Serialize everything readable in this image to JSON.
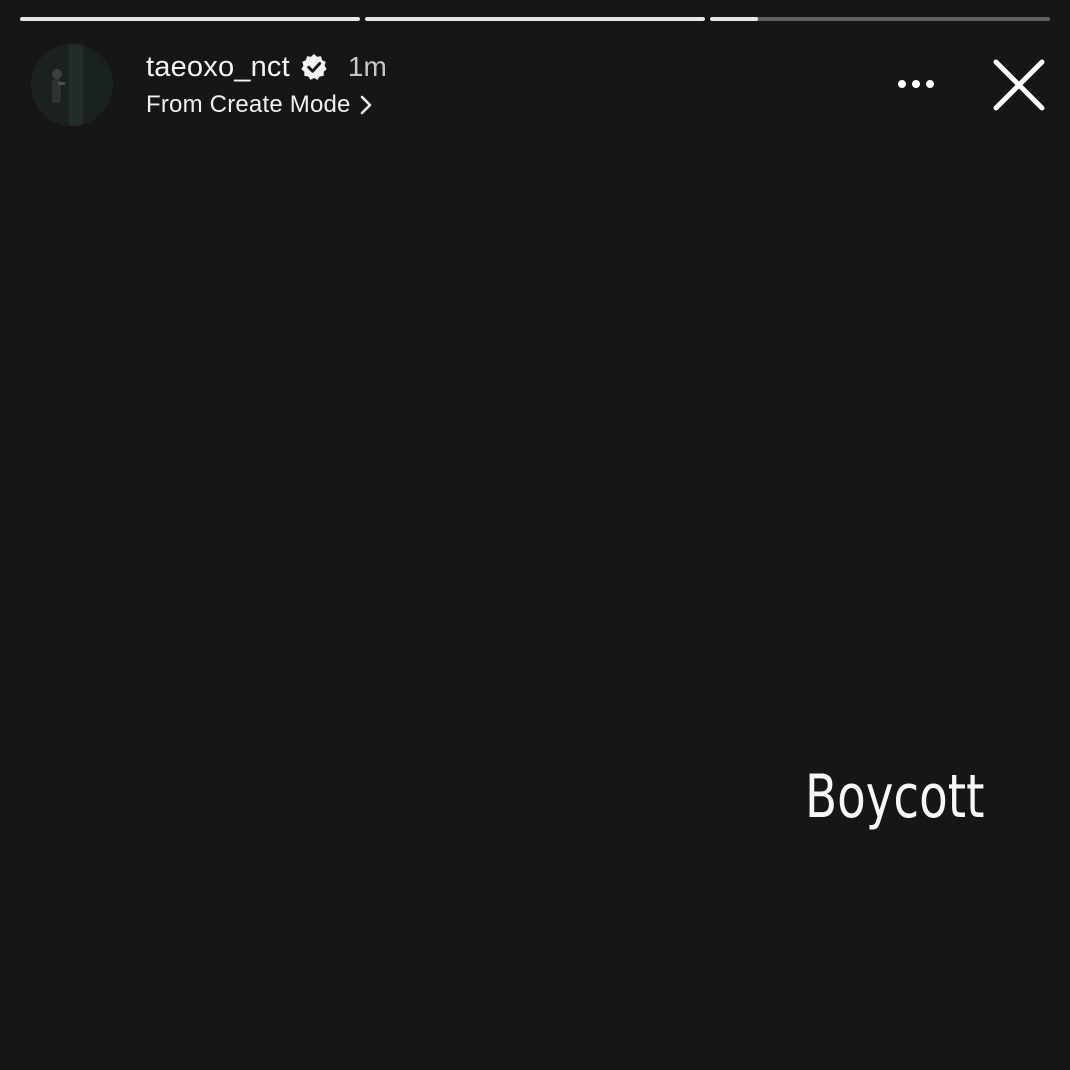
{
  "story": {
    "progress": [
      1.0,
      1.0,
      0.14
    ],
    "account": {
      "username": "taeoxo_nct",
      "verified": true,
      "timestamp": "1m",
      "subtitle": "From Create Mode"
    },
    "text": "Boycott",
    "icons": {
      "more": "more-horizontal-icon",
      "close": "close-icon",
      "verified": "verified-badge-icon",
      "chevron": "chevron-right-icon"
    },
    "colors": {
      "background": "#161616",
      "text": "#ffffff",
      "progress_filled": "#e6e6e6",
      "progress_track": "#5a5a5a"
    }
  }
}
